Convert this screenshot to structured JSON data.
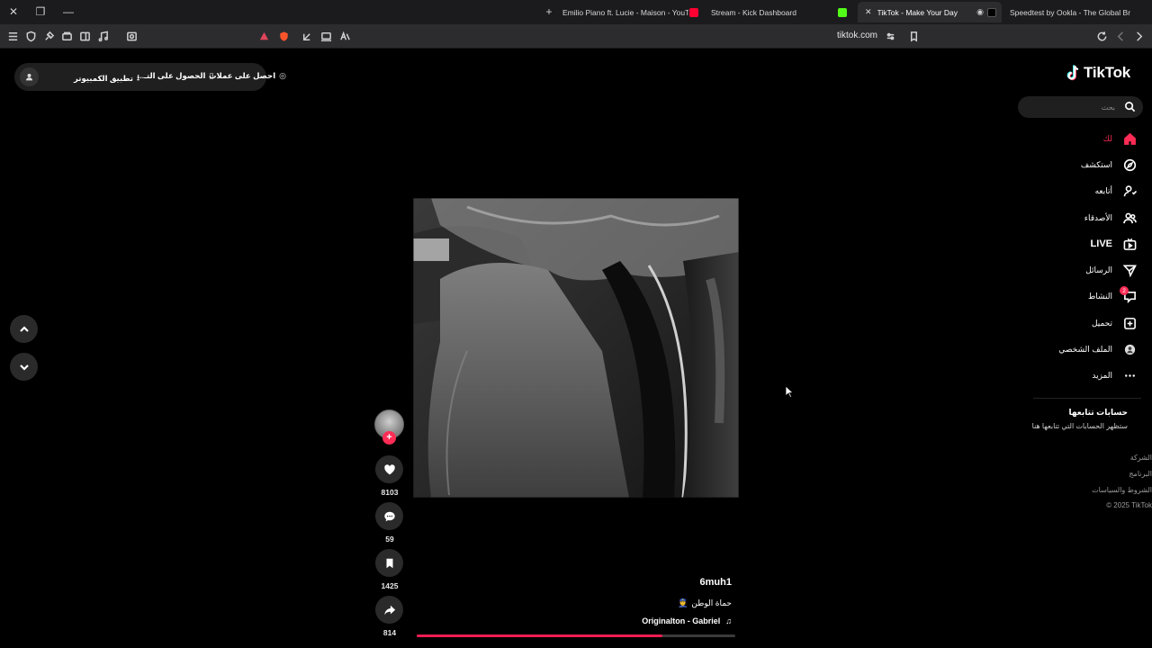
{
  "browser": {
    "tabs": [
      {
        "label": "Emilio Piano ft. Lucie - Maison - YouTube",
        "active": false
      },
      {
        "label": "Stream - Kick Dashboard",
        "active": false
      },
      {
        "label": "TikTok - Make Your Day",
        "active": true
      },
      {
        "label": "Speedtest by Ookla - The Global Broadband Speed Test",
        "active": false
      }
    ],
    "url": "tiktok.com"
  },
  "topbar": {
    "coins_label": "احصل على عملات",
    "app_label": "الحصول على التـ...",
    "desktop_label": "تطبيق الكمبيوتر"
  },
  "sidebar": {
    "logo": "TikTok",
    "search_placeholder": "بحث",
    "items": [
      {
        "label": "لك",
        "icon": "home-icon"
      },
      {
        "label": "استكشف",
        "icon": "explore-icon"
      },
      {
        "label": "أتابعه",
        "icon": "following-icon"
      },
      {
        "label": "الأصدقاء",
        "icon": "friends-icon"
      },
      {
        "label": "LIVE",
        "icon": "live-icon"
      },
      {
        "label": "الرسائل",
        "icon": "messages-icon"
      },
      {
        "label": "النشاط",
        "icon": "activity-icon",
        "badge": "2"
      },
      {
        "label": "تحميل",
        "icon": "upload-icon"
      },
      {
        "label": "الملف الشخصي",
        "icon": "profile-icon"
      },
      {
        "label": "المزيد",
        "icon": "more-icon"
      }
    ],
    "following_title": "حسابات تتابعها",
    "following_subtitle": "ستظهر الحسابات التي تتابعها هنا",
    "footer": [
      "الشركة",
      "البرنامج",
      "الشروط والسياسات",
      "© 2025 TikTok"
    ]
  },
  "video": {
    "username": "6muh1",
    "caption": "حماة الوطن",
    "caption_emoji": "👮",
    "music": "Originalton - Gabriel",
    "progress": 0.77
  },
  "actions": {
    "likes": "8103",
    "comments": "59",
    "saves": "1425",
    "shares": "814"
  },
  "colors": {
    "accent": "#fe2c55",
    "background": "#000000",
    "chrome": "#2c2c2f"
  }
}
